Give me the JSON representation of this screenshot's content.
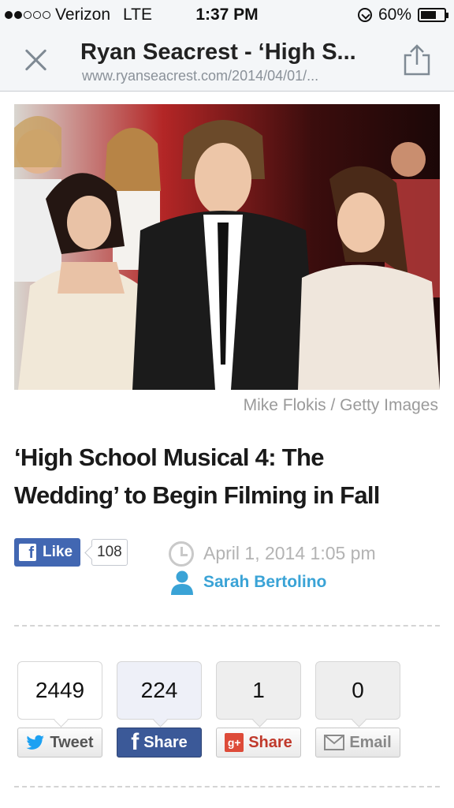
{
  "status_bar": {
    "carrier": "Verizon",
    "network": "LTE",
    "time": "1:37 PM",
    "battery": "60%",
    "battery_level": 0.6,
    "signal_bars_filled": 2,
    "signal_bars_total": 5
  },
  "nav": {
    "title": "Ryan Seacrest - ‘High S...",
    "url": "www.ryanseacrest.com/2014/04/01/..."
  },
  "photo": {
    "credit": "Mike Flokis / Getty Images"
  },
  "article": {
    "headline_line1": "‘High School Musical 4: The",
    "headline_line2": "Wedding’ to Begin Filming in Fall",
    "date": "April 1, 2014 1:05 pm",
    "author": "Sarah Bertolino"
  },
  "facebook_like": {
    "label": "Like",
    "count": "108"
  },
  "share": {
    "tweet_count": "2449",
    "facebook_count": "224",
    "googleplus_count": "1",
    "email_count": "0",
    "tweet_label": "Tweet",
    "facebook_label": "Share",
    "googleplus_label": "Share",
    "email_label": "Email"
  },
  "colors": {
    "facebook": "#3b5998",
    "author_link": "#3aa3d6",
    "twitter": "#1da1f2",
    "googleplus": "#dd4b39"
  },
  "icons": [
    "close-icon",
    "share-upload-icon",
    "clock-icon",
    "person-icon",
    "twitter-bird-icon",
    "facebook-f-icon",
    "google-plus-icon",
    "mail-icon",
    "lock-rotation-icon",
    "battery-icon"
  ]
}
